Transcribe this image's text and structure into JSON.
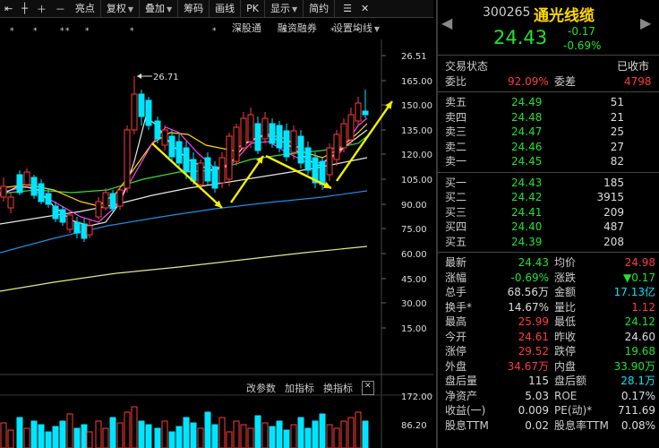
{
  "toolbar": {
    "items": [
      "亮点",
      "复权",
      "叠加",
      "筹码",
      "画线",
      "PK",
      "显示",
      "简约"
    ],
    "dropdowns": [
      false,
      true,
      true,
      false,
      false,
      false,
      true,
      false
    ]
  },
  "chart": {
    "top_links": [
      "深股通",
      "融资融券",
      "设置均线"
    ],
    "bottom_links": [
      "改参数",
      "加指标",
      "换指标"
    ],
    "high_annot": "26.71",
    "price_labels": [
      "26.51",
      "165.00",
      "150.00",
      "135.00",
      "120.00",
      "105.00",
      "90.00",
      "75.00",
      "60.00",
      "45.00",
      "30.00",
      "15.00"
    ],
    "volume_labels": [
      "172.00",
      "86.20"
    ],
    "colors": {
      "up": "#ff3b3b",
      "down": "#00e5ff",
      "ma_white": "#e6e6e6",
      "ma_yellow": "#ffd800",
      "ma_magenta": "#ff44ff",
      "ma_green": "#33dd33",
      "ma_blue": "#1d8fe0",
      "ma_gold": "#e8e68a",
      "arrow": "#f5f000"
    }
  },
  "quote": {
    "code": "300265",
    "name": "通光线缆",
    "price": "24.43",
    "change": "-0.17",
    "change_pct": "-0.69%",
    "status_label": "交易状态",
    "status_value": "已收市",
    "weibi_label": "委比",
    "weibi_value": "92.09%",
    "weicha_label": "委差",
    "weicha_value": "4798",
    "asks": [
      {
        "label": "卖五",
        "price": "24.49",
        "vol": "51"
      },
      {
        "label": "卖四",
        "price": "24.48",
        "vol": "21"
      },
      {
        "label": "卖三",
        "price": "24.47",
        "vol": "25"
      },
      {
        "label": "卖二",
        "price": "24.46",
        "vol": "27"
      },
      {
        "label": "卖一",
        "price": "24.45",
        "vol": "82"
      }
    ],
    "bids": [
      {
        "label": "买一",
        "price": "24.43",
        "vol": "185"
      },
      {
        "label": "买二",
        "price": "24.42",
        "vol": "3915"
      },
      {
        "label": "买三",
        "price": "24.41",
        "vol": "209"
      },
      {
        "label": "买四",
        "price": "24.40",
        "vol": "487"
      },
      {
        "label": "买五",
        "price": "24.39",
        "vol": "208"
      }
    ],
    "stats": [
      {
        "l1": "最新",
        "v1": "24.43",
        "c1": "green",
        "l2": "均价",
        "v2": "24.98",
        "c2": "red"
      },
      {
        "l1": "涨幅",
        "v1": "-0.69%",
        "c1": "green",
        "l2": "涨跌",
        "v2": "▼0.17",
        "c2": "green"
      },
      {
        "l1": "总手",
        "v1": "68.56万",
        "c1": "white",
        "l2": "金额",
        "v2": "17.13亿",
        "c2": "cyan"
      },
      {
        "l1": "换手*",
        "v1": "14.67%",
        "c1": "white",
        "l2": "量比",
        "v2": "1.12",
        "c2": "red"
      },
      {
        "l1": "最高",
        "v1": "25.99",
        "c1": "red",
        "l2": "最低",
        "v2": "24.12",
        "c2": "green"
      },
      {
        "l1": "今开",
        "v1": "24.61",
        "c1": "red",
        "l2": "昨收",
        "v2": "24.60",
        "c2": "white"
      },
      {
        "l1": "涨停",
        "v1": "29.52",
        "c1": "red",
        "l2": "跌停",
        "v2": "19.68",
        "c2": "green"
      },
      {
        "l1": "外盘",
        "v1": "34.67万",
        "c1": "red",
        "l2": "内盘",
        "v2": "33.90万",
        "c2": "green"
      },
      {
        "l1": "盘后量",
        "v1": "115",
        "c1": "white",
        "l2": "盘后额",
        "v2": "28.1万",
        "c2": "cyan"
      },
      {
        "l1": "净资产",
        "v1": "5.03",
        "c1": "white",
        "l2": "ROE",
        "v2": "0.17%",
        "c2": "white"
      },
      {
        "l1": "收益(一)",
        "v1": "0.009",
        "c1": "white",
        "l2": "PE(动)*",
        "v2": "711.69",
        "c2": "white"
      },
      {
        "l1": "股息TTM",
        "v1": "0.02",
        "c1": "white",
        "l2": "股息率TTM",
        "v2": "0.08%",
        "c2": "white"
      }
    ]
  }
}
